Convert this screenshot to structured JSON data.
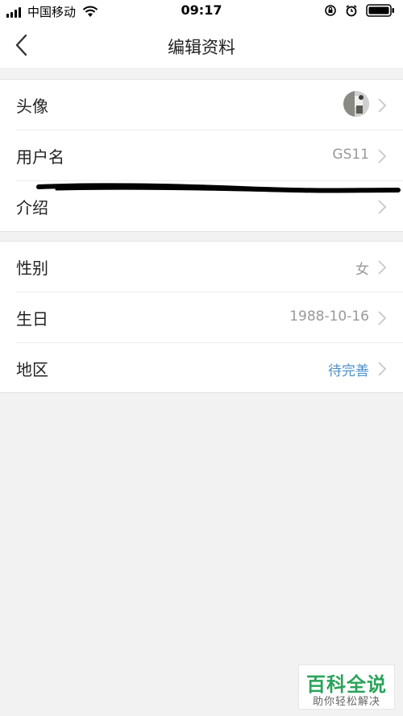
{
  "status_bar": {
    "carrier": "中国移动",
    "time": "09:17"
  },
  "nav": {
    "title": "编辑资料"
  },
  "profile_group": {
    "avatar_label": "头像",
    "username_label": "用户名",
    "username_value": "GS11",
    "intro_label": "介绍"
  },
  "info_group": {
    "gender_label": "性别",
    "gender_value": "女",
    "birthday_label": "生日",
    "birthday_value": "1988-10-16",
    "region_label": "地区",
    "region_value": "待完善"
  },
  "watermark": {
    "title": "百科全说",
    "subtitle": "助你轻松解决"
  },
  "colors": {
    "accent": "#4a90c8",
    "value_gray": "#999999",
    "background": "#f2f2f2",
    "watermark_green": "#2aa35a"
  }
}
